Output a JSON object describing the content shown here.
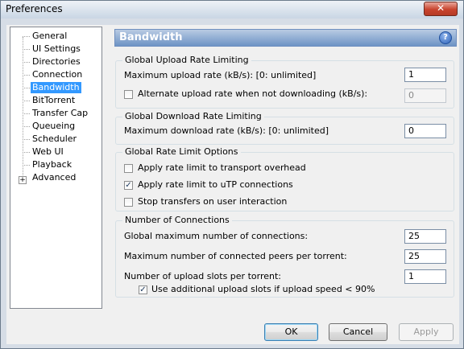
{
  "window": {
    "title": "Preferences",
    "close_glyph": "✕"
  },
  "tree": {
    "items": [
      {
        "label": "General"
      },
      {
        "label": "UI Settings"
      },
      {
        "label": "Directories"
      },
      {
        "label": "Connection"
      },
      {
        "label": "Bandwidth",
        "selected": true
      },
      {
        "label": "BitTorrent"
      },
      {
        "label": "Transfer Cap"
      },
      {
        "label": "Queueing"
      },
      {
        "label": "Scheduler"
      },
      {
        "label": "Web UI"
      },
      {
        "label": "Playback"
      },
      {
        "label": "Advanced",
        "expander": "+"
      }
    ]
  },
  "panel": {
    "title": "Bandwidth",
    "help_glyph": "?"
  },
  "upload": {
    "group_title": "Global Upload Rate Limiting",
    "max_label": "Maximum upload rate (kB/s): [0: unlimited]",
    "max_value": "1",
    "alt_label": "Alternate upload rate when not downloading (kB/s):",
    "alt_checked": false,
    "alt_value": "0"
  },
  "download": {
    "group_title": "Global Download Rate Limiting",
    "max_label": "Maximum download rate (kB/s): [0: unlimited]",
    "max_value": "0"
  },
  "options": {
    "group_title": "Global Rate Limit Options",
    "transport_label": "Apply rate limit to transport overhead",
    "transport_checked": false,
    "utp_label": "Apply rate limit to uTP connections",
    "utp_checked": true,
    "stop_label": "Stop transfers on user interaction",
    "stop_checked": false
  },
  "connections": {
    "group_title": "Number of Connections",
    "global_label": "Global maximum number of connections:",
    "global_value": "25",
    "peers_label": "Maximum number of connected peers per torrent:",
    "peers_value": "25",
    "slots_label": "Number of upload slots per torrent:",
    "slots_value": "1",
    "extra_label": "Use additional upload slots if upload speed < 90%",
    "extra_checked": true
  },
  "buttons": {
    "ok": "OK",
    "cancel": "Cancel",
    "apply": "Apply"
  },
  "check_glyph": "✓"
}
